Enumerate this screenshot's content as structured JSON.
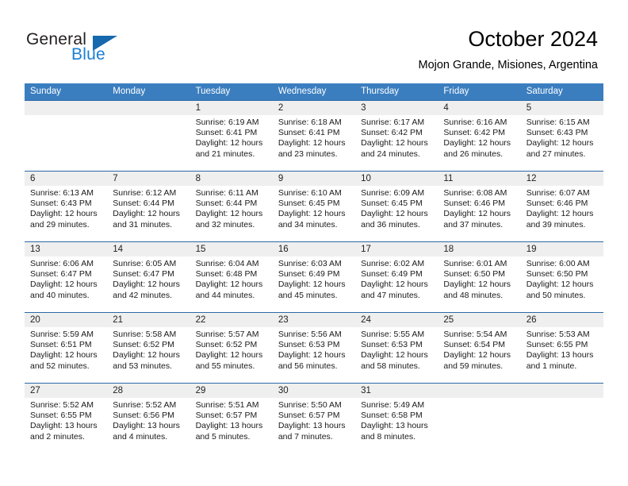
{
  "brand": {
    "name_part1": "General",
    "name_part2": "Blue",
    "accent_color": "#1769ad",
    "logo_icon": "triangle-logo-icon"
  },
  "header": {
    "month_title": "October 2024",
    "location": "Mojon Grande, Misiones, Argentina"
  },
  "calendar": {
    "header_bg": "#3b7ebf",
    "row_divider": "#2c6aa8",
    "date_band_bg": "#efefef",
    "weekdays": [
      "Sunday",
      "Monday",
      "Tuesday",
      "Wednesday",
      "Thursday",
      "Friday",
      "Saturday"
    ],
    "weeks": [
      [
        {
          "day": "",
          "sunrise": "",
          "sunset": "",
          "daylight1": "",
          "daylight2": ""
        },
        {
          "day": "",
          "sunrise": "",
          "sunset": "",
          "daylight1": "",
          "daylight2": ""
        },
        {
          "day": "1",
          "sunrise": "Sunrise: 6:19 AM",
          "sunset": "Sunset: 6:41 PM",
          "daylight1": "Daylight: 12 hours",
          "daylight2": "and 21 minutes."
        },
        {
          "day": "2",
          "sunrise": "Sunrise: 6:18 AM",
          "sunset": "Sunset: 6:41 PM",
          "daylight1": "Daylight: 12 hours",
          "daylight2": "and 23 minutes."
        },
        {
          "day": "3",
          "sunrise": "Sunrise: 6:17 AM",
          "sunset": "Sunset: 6:42 PM",
          "daylight1": "Daylight: 12 hours",
          "daylight2": "and 24 minutes."
        },
        {
          "day": "4",
          "sunrise": "Sunrise: 6:16 AM",
          "sunset": "Sunset: 6:42 PM",
          "daylight1": "Daylight: 12 hours",
          "daylight2": "and 26 minutes."
        },
        {
          "day": "5",
          "sunrise": "Sunrise: 6:15 AM",
          "sunset": "Sunset: 6:43 PM",
          "daylight1": "Daylight: 12 hours",
          "daylight2": "and 27 minutes."
        }
      ],
      [
        {
          "day": "6",
          "sunrise": "Sunrise: 6:13 AM",
          "sunset": "Sunset: 6:43 PM",
          "daylight1": "Daylight: 12 hours",
          "daylight2": "and 29 minutes."
        },
        {
          "day": "7",
          "sunrise": "Sunrise: 6:12 AM",
          "sunset": "Sunset: 6:44 PM",
          "daylight1": "Daylight: 12 hours",
          "daylight2": "and 31 minutes."
        },
        {
          "day": "8",
          "sunrise": "Sunrise: 6:11 AM",
          "sunset": "Sunset: 6:44 PM",
          "daylight1": "Daylight: 12 hours",
          "daylight2": "and 32 minutes."
        },
        {
          "day": "9",
          "sunrise": "Sunrise: 6:10 AM",
          "sunset": "Sunset: 6:45 PM",
          "daylight1": "Daylight: 12 hours",
          "daylight2": "and 34 minutes."
        },
        {
          "day": "10",
          "sunrise": "Sunrise: 6:09 AM",
          "sunset": "Sunset: 6:45 PM",
          "daylight1": "Daylight: 12 hours",
          "daylight2": "and 36 minutes."
        },
        {
          "day": "11",
          "sunrise": "Sunrise: 6:08 AM",
          "sunset": "Sunset: 6:46 PM",
          "daylight1": "Daylight: 12 hours",
          "daylight2": "and 37 minutes."
        },
        {
          "day": "12",
          "sunrise": "Sunrise: 6:07 AM",
          "sunset": "Sunset: 6:46 PM",
          "daylight1": "Daylight: 12 hours",
          "daylight2": "and 39 minutes."
        }
      ],
      [
        {
          "day": "13",
          "sunrise": "Sunrise: 6:06 AM",
          "sunset": "Sunset: 6:47 PM",
          "daylight1": "Daylight: 12 hours",
          "daylight2": "and 40 minutes."
        },
        {
          "day": "14",
          "sunrise": "Sunrise: 6:05 AM",
          "sunset": "Sunset: 6:47 PM",
          "daylight1": "Daylight: 12 hours",
          "daylight2": "and 42 minutes."
        },
        {
          "day": "15",
          "sunrise": "Sunrise: 6:04 AM",
          "sunset": "Sunset: 6:48 PM",
          "daylight1": "Daylight: 12 hours",
          "daylight2": "and 44 minutes."
        },
        {
          "day": "16",
          "sunrise": "Sunrise: 6:03 AM",
          "sunset": "Sunset: 6:49 PM",
          "daylight1": "Daylight: 12 hours",
          "daylight2": "and 45 minutes."
        },
        {
          "day": "17",
          "sunrise": "Sunrise: 6:02 AM",
          "sunset": "Sunset: 6:49 PM",
          "daylight1": "Daylight: 12 hours",
          "daylight2": "and 47 minutes."
        },
        {
          "day": "18",
          "sunrise": "Sunrise: 6:01 AM",
          "sunset": "Sunset: 6:50 PM",
          "daylight1": "Daylight: 12 hours",
          "daylight2": "and 48 minutes."
        },
        {
          "day": "19",
          "sunrise": "Sunrise: 6:00 AM",
          "sunset": "Sunset: 6:50 PM",
          "daylight1": "Daylight: 12 hours",
          "daylight2": "and 50 minutes."
        }
      ],
      [
        {
          "day": "20",
          "sunrise": "Sunrise: 5:59 AM",
          "sunset": "Sunset: 6:51 PM",
          "daylight1": "Daylight: 12 hours",
          "daylight2": "and 52 minutes."
        },
        {
          "day": "21",
          "sunrise": "Sunrise: 5:58 AM",
          "sunset": "Sunset: 6:52 PM",
          "daylight1": "Daylight: 12 hours",
          "daylight2": "and 53 minutes."
        },
        {
          "day": "22",
          "sunrise": "Sunrise: 5:57 AM",
          "sunset": "Sunset: 6:52 PM",
          "daylight1": "Daylight: 12 hours",
          "daylight2": "and 55 minutes."
        },
        {
          "day": "23",
          "sunrise": "Sunrise: 5:56 AM",
          "sunset": "Sunset: 6:53 PM",
          "daylight1": "Daylight: 12 hours",
          "daylight2": "and 56 minutes."
        },
        {
          "day": "24",
          "sunrise": "Sunrise: 5:55 AM",
          "sunset": "Sunset: 6:53 PM",
          "daylight1": "Daylight: 12 hours",
          "daylight2": "and 58 minutes."
        },
        {
          "day": "25",
          "sunrise": "Sunrise: 5:54 AM",
          "sunset": "Sunset: 6:54 PM",
          "daylight1": "Daylight: 12 hours",
          "daylight2": "and 59 minutes."
        },
        {
          "day": "26",
          "sunrise": "Sunrise: 5:53 AM",
          "sunset": "Sunset: 6:55 PM",
          "daylight1": "Daylight: 13 hours",
          "daylight2": "and 1 minute."
        }
      ],
      [
        {
          "day": "27",
          "sunrise": "Sunrise: 5:52 AM",
          "sunset": "Sunset: 6:55 PM",
          "daylight1": "Daylight: 13 hours",
          "daylight2": "and 2 minutes."
        },
        {
          "day": "28",
          "sunrise": "Sunrise: 5:52 AM",
          "sunset": "Sunset: 6:56 PM",
          "daylight1": "Daylight: 13 hours",
          "daylight2": "and 4 minutes."
        },
        {
          "day": "29",
          "sunrise": "Sunrise: 5:51 AM",
          "sunset": "Sunset: 6:57 PM",
          "daylight1": "Daylight: 13 hours",
          "daylight2": "and 5 minutes."
        },
        {
          "day": "30",
          "sunrise": "Sunrise: 5:50 AM",
          "sunset": "Sunset: 6:57 PM",
          "daylight1": "Daylight: 13 hours",
          "daylight2": "and 7 minutes."
        },
        {
          "day": "31",
          "sunrise": "Sunrise: 5:49 AM",
          "sunset": "Sunset: 6:58 PM",
          "daylight1": "Daylight: 13 hours",
          "daylight2": "and 8 minutes."
        },
        {
          "day": "",
          "sunrise": "",
          "sunset": "",
          "daylight1": "",
          "daylight2": ""
        },
        {
          "day": "",
          "sunrise": "",
          "sunset": "",
          "daylight1": "",
          "daylight2": ""
        }
      ]
    ]
  }
}
